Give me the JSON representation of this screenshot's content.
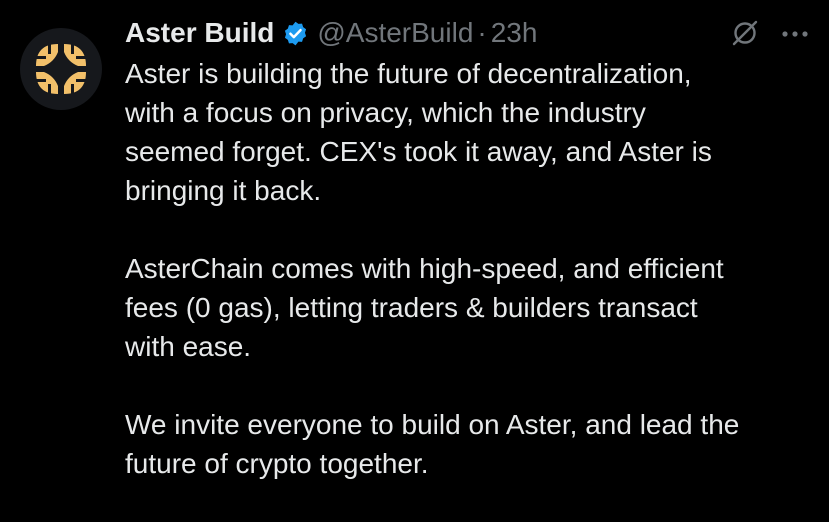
{
  "tweet": {
    "author": {
      "display_name": "Aster Build",
      "handle": "@AsterBuild",
      "verified": true,
      "avatar_icon": "aster-logo-icon"
    },
    "separator": "·",
    "time": "23h",
    "paragraphs": [
      "Aster is building the future of decentralization,\nwith a focus on privacy, which the industry\nseemed forget. CEX's took it away, and Aster is\nbringing it back.",
      "AsterChain comes with high-speed, and efficient\nfees (0 gas), letting traders & builders transact\nwith ease.",
      "We invite everyone to build on Aster, and lead the\nfuture of crypto together."
    ]
  },
  "icons": {
    "verified": "verified-badge-icon",
    "grok": "grok-icon",
    "more": "more-options-icon"
  },
  "colors": {
    "background": "#000000",
    "text": "#e7e9ea",
    "secondary": "#71767b",
    "verified": "#1d9bf0",
    "logo_gold": "#f2c06a"
  }
}
